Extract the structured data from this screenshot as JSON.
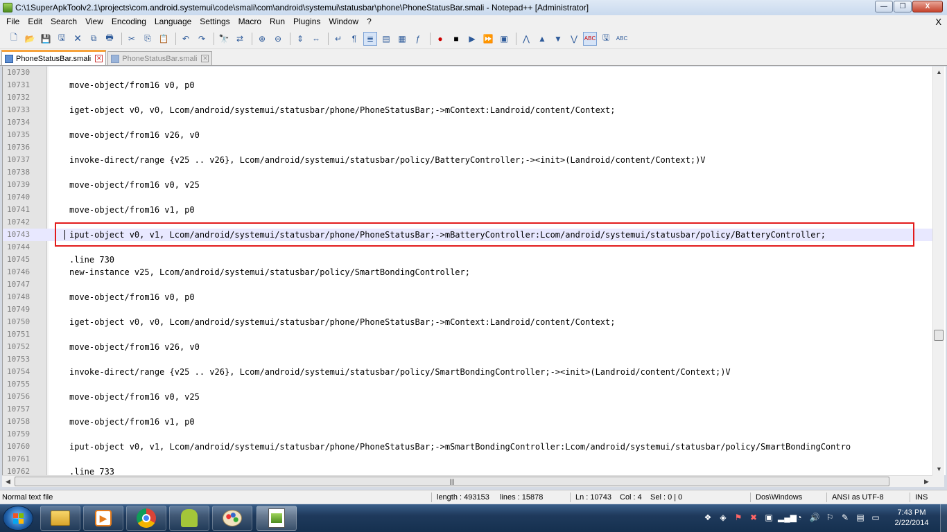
{
  "window": {
    "title": "C:\\1SuperApkToolv2.1\\projects\\com.android.systemui\\code\\smali\\com\\android\\systemui\\statusbar\\phone\\PhoneStatusBar.smali - Notepad++ [Administrator]",
    "minimize": "—",
    "maximize": "❐",
    "close": "X"
  },
  "menu": {
    "items": [
      "File",
      "Edit",
      "Search",
      "View",
      "Encoding",
      "Language",
      "Settings",
      "Macro",
      "Run",
      "Plugins",
      "Window",
      "?"
    ],
    "close": "X"
  },
  "tabs": [
    {
      "label": "PhoneStatusBar.smali",
      "active": true
    },
    {
      "label": "PhoneStatusBar.smali",
      "active": false
    }
  ],
  "editor": {
    "current_line": "10743",
    "lines": [
      {
        "n": "10730",
        "code": ""
      },
      {
        "n": "10731",
        "code": "move-object/from16 v0, p0"
      },
      {
        "n": "10732",
        "code": ""
      },
      {
        "n": "10733",
        "code": "iget-object v0, v0, Lcom/android/systemui/statusbar/phone/PhoneStatusBar;->mContext:Landroid/content/Context;"
      },
      {
        "n": "10734",
        "code": ""
      },
      {
        "n": "10735",
        "code": "move-object/from16 v26, v0"
      },
      {
        "n": "10736",
        "code": ""
      },
      {
        "n": "10737",
        "code": "invoke-direct/range {v25 .. v26}, Lcom/android/systemui/statusbar/policy/BatteryController;-><init>(Landroid/content/Context;)V"
      },
      {
        "n": "10738",
        "code": ""
      },
      {
        "n": "10739",
        "code": "move-object/from16 v0, v25"
      },
      {
        "n": "10740",
        "code": ""
      },
      {
        "n": "10741",
        "code": "move-object/from16 v1, p0"
      },
      {
        "n": "10742",
        "code": ""
      },
      {
        "n": "10743",
        "code": "iput-object v0, v1, Lcom/android/systemui/statusbar/phone/PhoneStatusBar;->mBatteryController:Lcom/android/systemui/statusbar/policy/BatteryController;"
      },
      {
        "n": "10744",
        "code": ""
      },
      {
        "n": "10745",
        "code": ".line 730"
      },
      {
        "n": "10746",
        "code": "new-instance v25, Lcom/android/systemui/statusbar/policy/SmartBondingController;"
      },
      {
        "n": "10747",
        "code": ""
      },
      {
        "n": "10748",
        "code": "move-object/from16 v0, p0"
      },
      {
        "n": "10749",
        "code": ""
      },
      {
        "n": "10750",
        "code": "iget-object v0, v0, Lcom/android/systemui/statusbar/phone/PhoneStatusBar;->mContext:Landroid/content/Context;"
      },
      {
        "n": "10751",
        "code": ""
      },
      {
        "n": "10752",
        "code": "move-object/from16 v26, v0"
      },
      {
        "n": "10753",
        "code": ""
      },
      {
        "n": "10754",
        "code": "invoke-direct/range {v25 .. v26}, Lcom/android/systemui/statusbar/policy/SmartBondingController;-><init>(Landroid/content/Context;)V"
      },
      {
        "n": "10755",
        "code": ""
      },
      {
        "n": "10756",
        "code": "move-object/from16 v0, v25"
      },
      {
        "n": "10757",
        "code": ""
      },
      {
        "n": "10758",
        "code": "move-object/from16 v1, p0"
      },
      {
        "n": "10759",
        "code": ""
      },
      {
        "n": "10760",
        "code": "iput-object v0, v1, Lcom/android/systemui/statusbar/phone/PhoneStatusBar;->mSmartBondingController:Lcom/android/systemui/statusbar/policy/SmartBondingContro"
      },
      {
        "n": "10761",
        "code": ""
      },
      {
        "n": "10762",
        "code": ".line 733"
      }
    ]
  },
  "statusbar": {
    "file_type": "Normal text file",
    "length": "length : 493153",
    "lines": "lines : 15878",
    "ln": "Ln : 10743",
    "col": "Col : 4",
    "sel": "Sel : 0 | 0",
    "eol": "Dos\\Windows",
    "encoding": "ANSI as UTF-8",
    "mode": "INS"
  },
  "taskbar": {
    "apps": [
      "windows-explorer",
      "media-player",
      "chrome",
      "android-tool",
      "paint",
      "notepad-plus-plus"
    ],
    "clock_time": "7:43 PM",
    "clock_date": "2/22/2014"
  },
  "colors": {
    "highlight_border": "#e21a1a",
    "tab_accent": "#f6a23b",
    "current_line_bg": "#e8e8ff"
  }
}
